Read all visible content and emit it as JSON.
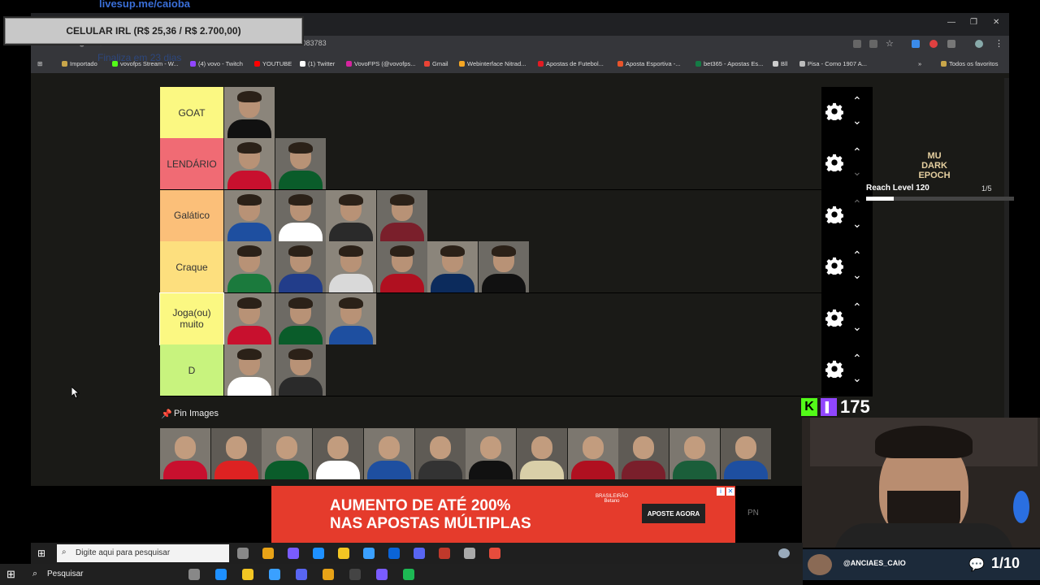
{
  "overlay": {
    "livesup_url": "livesup.me/caioba",
    "phone_goal": "CELULAR IRL (R$ 25,36 / R$ 2.700,00)",
    "ghost_text": "Finaliza em 23 dias"
  },
  "browser": {
    "url": "tiermaker.com/create/maiores-idolos-do-futebol-brasileiro-1083783",
    "bookmarks": [
      "Importado",
      "vovofps Stream - W...",
      "(4) vovo - Twitch",
      "YOUTUBE",
      "(1) Twitter",
      "VovoFPS (@vovofps...",
      "Gmail",
      "Webinterface Nitrad...",
      "Apostas de Futebol...",
      "Aposta Esportiva -...",
      "bet365 - Apostas Es...",
      "Bll",
      "Pisa - Como 1907 A...",
      "Todos os favoritos"
    ]
  },
  "tiers": [
    {
      "label": "GOAT",
      "color": "#fbf882",
      "count": 1
    },
    {
      "label": "LENDÁRIO",
      "color": "#f06b74",
      "count": 2
    },
    {
      "label": "Galático",
      "color": "#fbbf79",
      "count": 4
    },
    {
      "label": "Craque",
      "color": "#fddf7e",
      "count": 6
    },
    {
      "label": "Joga(ou) muito",
      "color": "#fbf882",
      "count": 3
    },
    {
      "label": "D",
      "color": "#c8f37e",
      "count": 2
    }
  ],
  "pin": {
    "label": "Pin Images",
    "count": 12
  },
  "ad": {
    "line1": "AUMENTO DE ATÉ 200%",
    "line2": "NAS APOSTAS MÚLTIPLAS",
    "cta": "APOSTE AGORA",
    "brand": "BRASILEIRÃO Betano",
    "side": "PN"
  },
  "game": {
    "logo_line1": "MU",
    "logo_line2": "DARK EPOCH",
    "quest": "Reach Level 120",
    "quest_count": "1/5"
  },
  "stream": {
    "sub_count": "175",
    "handle": "@ANCIAES_CAIO",
    "viewers": "1/10"
  },
  "taskbar": {
    "search_inner": "Digite aqui para pesquisar",
    "search_outer": "Pesquisar"
  },
  "colors": {
    "accent_twitch": "#9146ff",
    "kick": "#53fc18"
  }
}
